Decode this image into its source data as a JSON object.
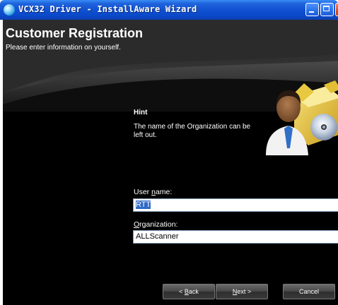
{
  "window": {
    "title": "VCX32 Driver - InstallAware Wizard",
    "colors": {
      "titlebar": "#0a48c8",
      "client_bg": "#000000",
      "input_border": "#7f9db9",
      "selection": "#316ac5"
    },
    "icons": [
      "app-icon",
      "minimize-icon",
      "maximize-icon",
      "close-icon"
    ]
  },
  "header": {
    "title": "Customer Registration",
    "subtitle": "Please enter information on yourself."
  },
  "hint": {
    "title": "Hint",
    "text": "The name of the Organization can be left out."
  },
  "form": {
    "user_name": {
      "label_pre": "User ",
      "label_accel": "n",
      "label_post": "ame:",
      "value": "RTT",
      "selected": true
    },
    "organization": {
      "label_pre": "",
      "label_accel": "O",
      "label_post": "rganization:",
      "value": "ALLScanner"
    }
  },
  "buttons": {
    "back": {
      "pre": "< ",
      "accel": "B",
      "post": "ack"
    },
    "next": {
      "pre": "",
      "accel": "N",
      "post": "ext >"
    },
    "cancel": {
      "label": "Cancel"
    }
  }
}
